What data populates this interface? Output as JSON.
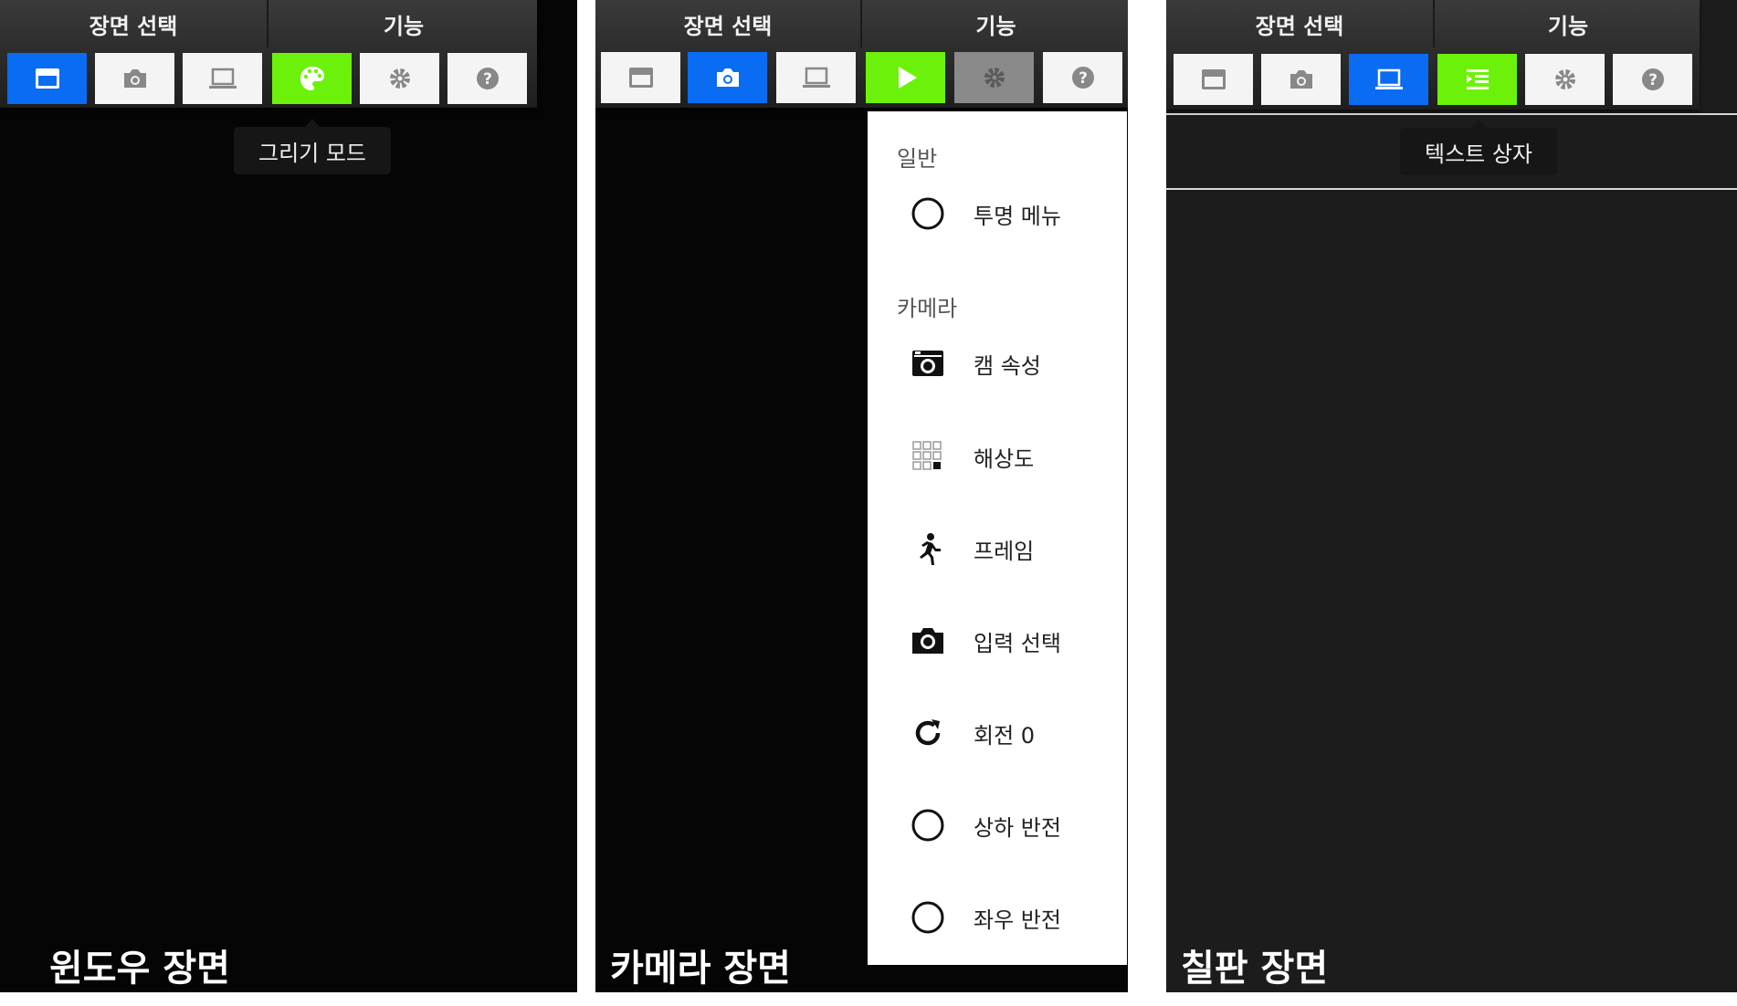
{
  "toolbar": {
    "scene_select": "장면 선택",
    "features": "기능"
  },
  "panels": [
    {
      "caption": "윈도우 장면",
      "tooltip": "그리기 모드"
    },
    {
      "caption": "카메라 장면"
    },
    {
      "caption": "칠판 장면",
      "tooltip": "텍스트 상자"
    }
  ],
  "menu": {
    "general_header": "일반",
    "camera_header": "카메라",
    "items": [
      {
        "label": "투명 메뉴",
        "icon": "radio-off-icon"
      },
      {
        "label": "캠 속성",
        "icon": "webcam-icon"
      },
      {
        "label": "해상도",
        "icon": "resolution-grid-icon"
      },
      {
        "label": "프레임",
        "icon": "running-person-icon"
      },
      {
        "label": "입력 선택",
        "icon": "camera-icon"
      },
      {
        "label": "회전 0",
        "icon": "rotate-icon"
      },
      {
        "label": "상하 반전",
        "icon": "radio-off-icon"
      },
      {
        "label": "좌우 반전",
        "icon": "radio-off-icon"
      }
    ]
  },
  "colors": {
    "blue": "#0a6cf3",
    "green": "#6cf20a",
    "gray": "#8a8a8a"
  }
}
